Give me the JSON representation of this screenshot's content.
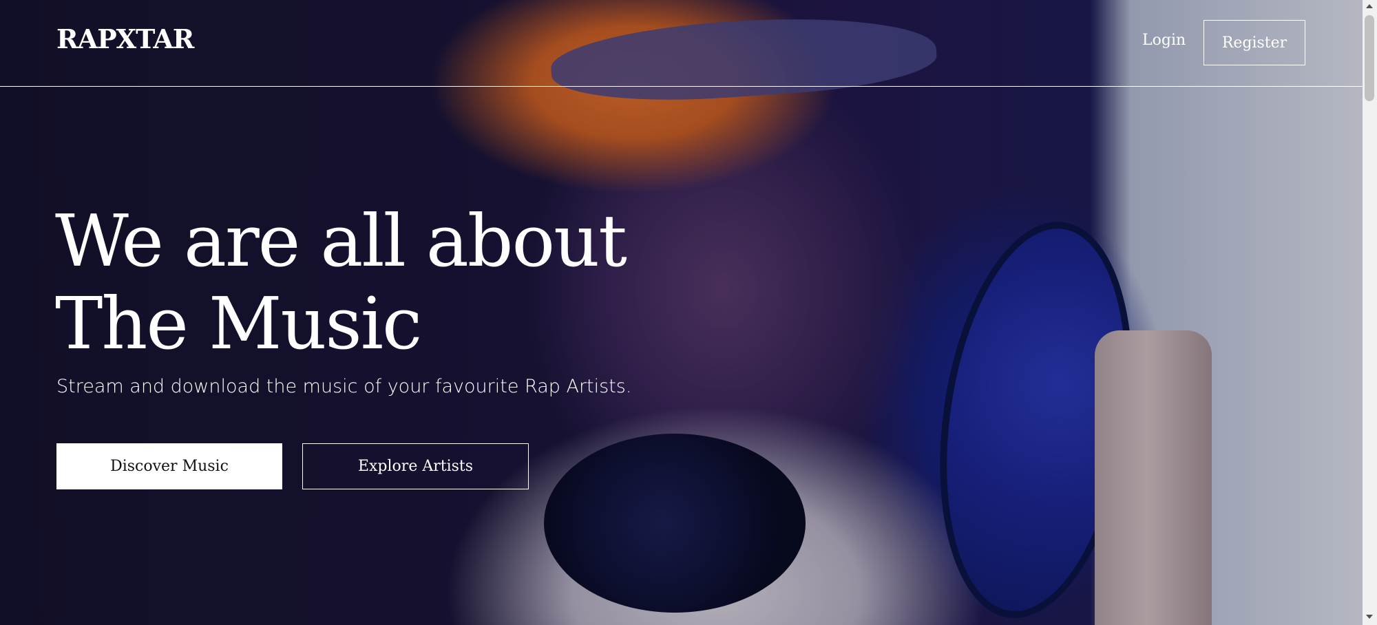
{
  "brand": {
    "name": "RAPXTAR"
  },
  "nav": {
    "login_label": "Login",
    "register_label": "Register"
  },
  "hero": {
    "title_line1": "We are all about",
    "title_line2": "The Music",
    "subtitle": "Stream and download the music of your favourite Rap Artists.",
    "primary_cta": "Discover Music",
    "secondary_cta": "Explore Artists",
    "background_image": "hero-rapper-studio-photo"
  },
  "colors": {
    "text": "#ffffff",
    "primary_button_bg": "#ffffff",
    "primary_button_text": "#111111"
  }
}
